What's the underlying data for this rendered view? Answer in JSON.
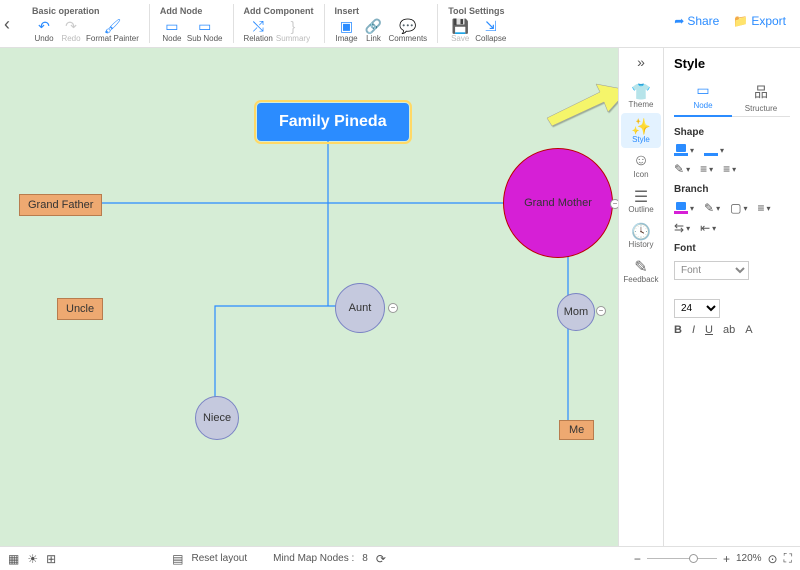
{
  "toolbar": {
    "groups": [
      {
        "title": "Basic operation",
        "items": [
          {
            "id": "undo",
            "label": "Undo",
            "icon": "↶"
          },
          {
            "id": "redo",
            "label": "Redo",
            "icon": "↷",
            "disabled": true
          },
          {
            "id": "fmt",
            "label": "Format Painter",
            "icon": "🖌"
          }
        ]
      },
      {
        "title": "Add Node",
        "items": [
          {
            "id": "node",
            "label": "Node",
            "icon": "▭"
          },
          {
            "id": "subnode",
            "label": "Sub Node",
            "icon": "▭"
          }
        ]
      },
      {
        "title": "Add Component",
        "items": [
          {
            "id": "relation",
            "label": "Relation",
            "icon": "⤭"
          },
          {
            "id": "summary",
            "label": "Summary",
            "icon": "}",
            "disabled": true
          }
        ]
      },
      {
        "title": "Insert",
        "items": [
          {
            "id": "image",
            "label": "Image",
            "icon": "▣"
          },
          {
            "id": "link",
            "label": "Link",
            "icon": "🔗"
          },
          {
            "id": "comments",
            "label": "Comments",
            "icon": "💬"
          }
        ]
      },
      {
        "title": "Tool Settings",
        "items": [
          {
            "id": "save",
            "label": "Save",
            "icon": "💾",
            "disabled": true
          },
          {
            "id": "collapse",
            "label": "Collapse",
            "icon": "⇲"
          }
        ]
      }
    ],
    "share": "Share",
    "export": "Export"
  },
  "nodes": {
    "root": "Family Pineda",
    "grandfather": "Grand Father",
    "grandmother": "Grand Mother",
    "uncle": "Uncle",
    "aunt": "Aunt",
    "mom": "Mom",
    "niece": "Niece",
    "me": "Me"
  },
  "rail": {
    "items": [
      {
        "id": "theme",
        "label": "Theme",
        "icon": "👕"
      },
      {
        "id": "style",
        "label": "Style",
        "icon": "✨",
        "active": true
      },
      {
        "id": "icon",
        "label": "Icon",
        "icon": "☺"
      },
      {
        "id": "outline",
        "label": "Outline",
        "icon": "☰"
      },
      {
        "id": "history",
        "label": "History",
        "icon": "🕓"
      },
      {
        "id": "feedback",
        "label": "Feedback",
        "icon": "✎"
      }
    ]
  },
  "panel": {
    "title": "Style",
    "tabs": [
      {
        "id": "node",
        "label": "Node",
        "icon": "▭",
        "active": true
      },
      {
        "id": "structure",
        "label": "Structure",
        "icon": "品"
      }
    ],
    "sections": {
      "shape": "Shape",
      "branch": "Branch",
      "font": "Font"
    },
    "font_placeholder": "Font",
    "font_size": "24"
  },
  "status": {
    "reset": "Reset layout",
    "nodes_label": "Mind Map Nodes :",
    "node_count": "8",
    "zoom": "120%"
  }
}
